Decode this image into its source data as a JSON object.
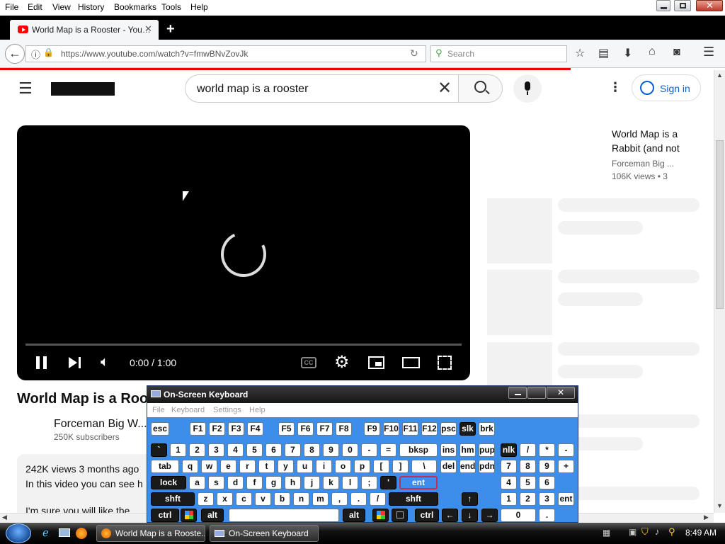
{
  "menubar": {
    "items": [
      "File",
      "Edit",
      "View",
      "History",
      "Bookmarks",
      "Tools",
      "Help"
    ]
  },
  "browser": {
    "tab_title": "World Map is a Rooster - You…",
    "url": "https://www.youtube.com/watch?v=fmwBNvZovJk",
    "search_placeholder": "Search"
  },
  "youtube": {
    "search_value": "world map is a rooster",
    "sign_in": "Sign in",
    "time": "0:00 / 1:00",
    "video_title": "World Map is a Roo",
    "channel": "Forceman Big W...",
    "subscribers": "250K subscribers",
    "meta": "242K views  3 months ago",
    "description": "In this video you can see h",
    "description2": "I'm sure you will like the",
    "related": {
      "title_line1": "World Map is a",
      "title_line2": "Rabbit (and not",
      "channel": "Forceman Big ...",
      "meta": "106K views  • 3"
    }
  },
  "osk": {
    "title": "On-Screen Keyboard",
    "menu": [
      "File",
      "Keyboard",
      "Settings",
      "Help"
    ],
    "rows": [
      [
        "esc",
        "F1",
        "F2",
        "F3",
        "F4",
        "F5",
        "F6",
        "F7",
        "F8",
        "F9",
        "F10",
        "F11",
        "F12",
        "psc",
        "slk",
        "brk"
      ],
      [
        "`",
        "1",
        "2",
        "3",
        "4",
        "5",
        "6",
        "7",
        "8",
        "9",
        "0",
        "-",
        "=",
        "bksp",
        "ins",
        "hm",
        "pup",
        "nlk",
        "/",
        "*",
        "-"
      ],
      [
        "tab",
        "q",
        "w",
        "e",
        "r",
        "t",
        "y",
        "u",
        "i",
        "o",
        "p",
        "[",
        "]",
        "\\",
        "del",
        "end",
        "pdn",
        "7",
        "8",
        "9",
        "+"
      ],
      [
        "lock",
        "a",
        "s",
        "d",
        "f",
        "g",
        "h",
        "j",
        "k",
        "l",
        ";",
        "'",
        "ent",
        "4",
        "5",
        "6"
      ],
      [
        "shft",
        "z",
        "x",
        "c",
        "v",
        "b",
        "n",
        "m",
        ",",
        ".",
        "/",
        "shft",
        "↑",
        "1",
        "2",
        "3",
        "ent"
      ],
      [
        "ctrl",
        "alt",
        "alt",
        "ctrl",
        "←",
        "↓",
        "→",
        "0",
        "."
      ]
    ]
  },
  "taskbar": {
    "items": [
      "World Map is a Rooste...",
      "On-Screen Keyboard"
    ],
    "clock": "8:49 AM"
  }
}
